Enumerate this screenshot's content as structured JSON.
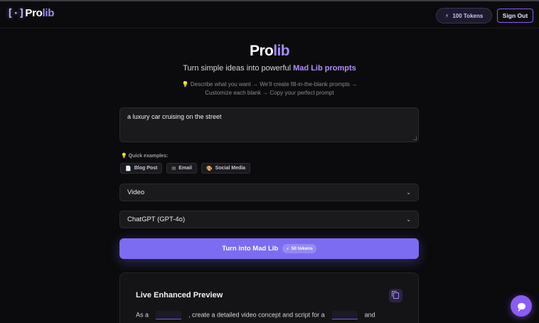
{
  "header": {
    "logo_mark": "[·]",
    "logo_pro": "Pro",
    "logo_lib": "lib",
    "tokens_label": "100 Tokens",
    "tokens_icon": "⚡",
    "signout_label": "Sign Out"
  },
  "hero": {
    "title_pro": "Pro",
    "title_lib": "lib",
    "subtitle_prefix": "Turn simple ideas into powerful ",
    "subtitle_highlight": "Mad Lib prompts",
    "steps_line1": "💡 Describe what you want → We'll create fill-in-the-blank prompts →",
    "steps_line2": "Customize each blank → Copy your perfect prompt"
  },
  "input": {
    "value": "a luxury car cruising on the street"
  },
  "quick_examples": {
    "label": "💡 Quick examples:",
    "chips": [
      {
        "icon": "📄",
        "label": "Blog Post"
      },
      {
        "icon": "✉",
        "label": "Email"
      },
      {
        "icon": "🎨",
        "label": "Social Media"
      }
    ]
  },
  "selects": {
    "type": {
      "value": "Video"
    },
    "model": {
      "value": "ChatGPT (GPT-4o)"
    }
  },
  "cta": {
    "label": "Turn into Mad Lib",
    "badge_icon": "⚡",
    "badge_label": "50 tokens"
  },
  "preview": {
    "title": "Live Enhanced Preview",
    "text_1": "As a",
    "text_2": ", create a detailed video concept and script for a",
    "text_3": "and"
  },
  "colors": {
    "accent": "#7c6cf2",
    "brand_purple": "#a78bfa",
    "background": "#0b0b0d"
  }
}
